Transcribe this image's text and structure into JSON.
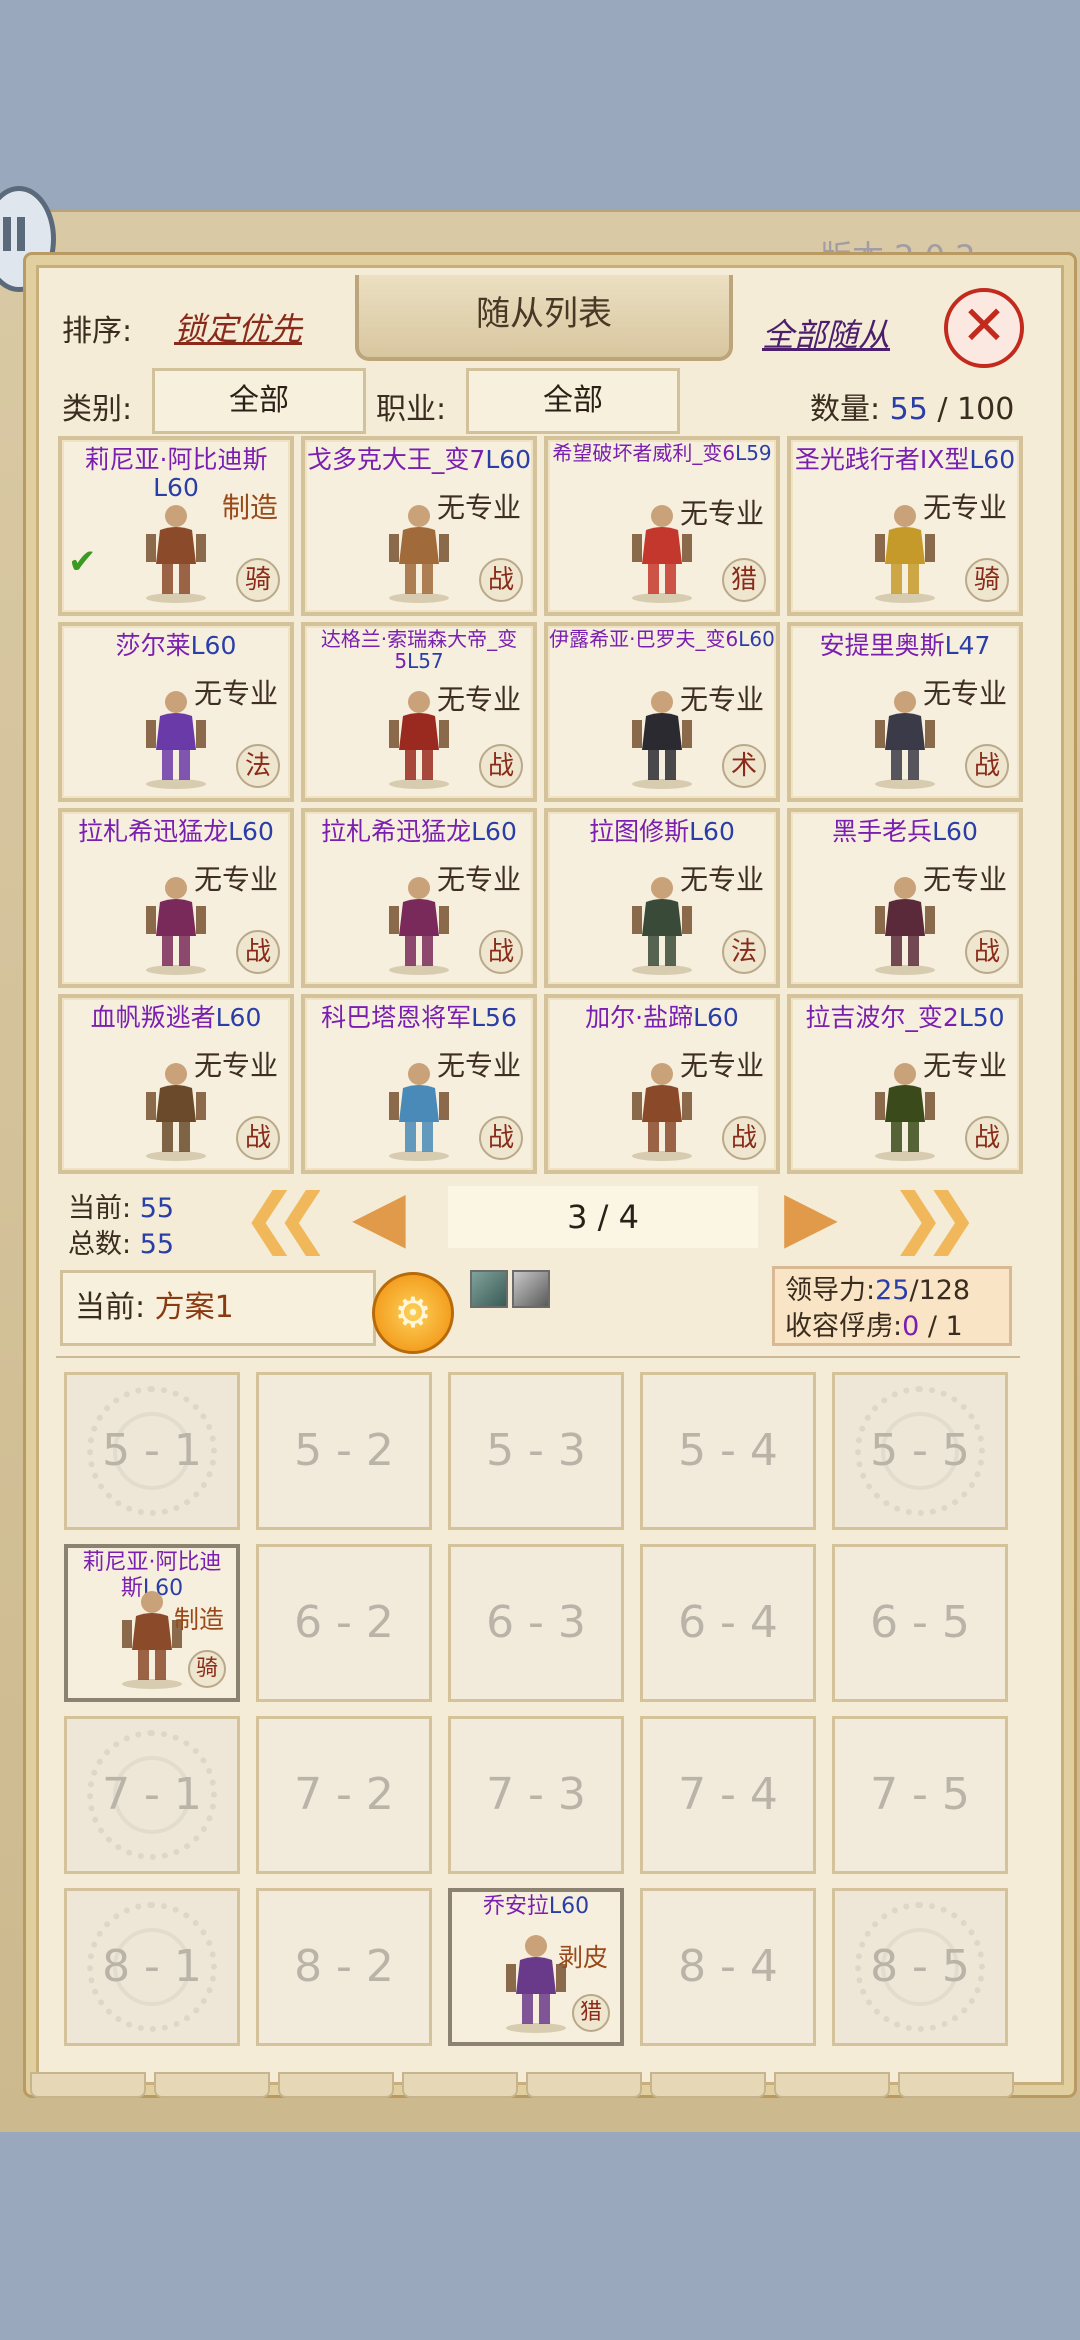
{
  "header": {
    "version_text": "版本 2.0.2",
    "title": "随从列表",
    "sort_label": "排序:",
    "sort_value": "锁定优先",
    "all_followers": "全部随从",
    "close_icon": "close-icon"
  },
  "filters": {
    "category_label": "类别:",
    "category_value": "全部",
    "job_label": "职业:",
    "job_value": "全部",
    "count_label": "数量:",
    "count_current": "55",
    "count_sep": " / ",
    "count_max": "100"
  },
  "cards": [
    {
      "name": "莉尼亚·阿比迪斯",
      "level": "L60",
      "prof": "制造",
      "cls": "骑",
      "crafted": true,
      "checked": true,
      "color": "#8b4a2a"
    },
    {
      "name": "戈多克大王_变7",
      "level": "L60",
      "prof": "无专业",
      "cls": "战",
      "color": "#a06a3a"
    },
    {
      "name": "希望破坏者威利_变6",
      "level": "L59",
      "prof": "无专业",
      "cls": "猎",
      "small": true,
      "color": "#c4372c"
    },
    {
      "name": "圣光践行者IX型",
      "level": "L60",
      "prof": "无专业",
      "cls": "骑",
      "color": "#c69a2a"
    },
    {
      "name": "莎尔莱",
      "level": "L60",
      "prof": "无专业",
      "cls": "法",
      "color": "#6a3aa8"
    },
    {
      "name": "达格兰·索瑞森大帝_变5",
      "level": "L57",
      "prof": "无专业",
      "cls": "战",
      "small": true,
      "color": "#9a2a20"
    },
    {
      "name": "伊露希亚·巴罗夫_变6",
      "level": "L60",
      "prof": "无专业",
      "cls": "术",
      "small": true,
      "color": "#2a2a30"
    },
    {
      "name": "安提里奥斯",
      "level": "L47",
      "prof": "无专业",
      "cls": "战",
      "color": "#3a3a48"
    },
    {
      "name": "拉札希迅猛龙",
      "level": "L60",
      "prof": "无专业",
      "cls": "战",
      "color": "#7a2a5a"
    },
    {
      "name": "拉札希迅猛龙",
      "level": "L60",
      "prof": "无专业",
      "cls": "战",
      "color": "#7a2a5a"
    },
    {
      "name": "拉图修斯",
      "level": "L60",
      "prof": "无专业",
      "cls": "法",
      "color": "#3a4a38"
    },
    {
      "name": "黑手老兵",
      "level": "L60",
      "prof": "无专业",
      "cls": "战",
      "color": "#5a2a3a"
    },
    {
      "name": "血帆叛逃者",
      "level": "L60",
      "prof": "无专业",
      "cls": "战",
      "color": "#6a4a2a"
    },
    {
      "name": "科巴塔恩将军",
      "level": "L56",
      "prof": "无专业",
      "cls": "战",
      "color": "#4a8ab8"
    },
    {
      "name": "加尔·盐蹄",
      "level": "L60",
      "prof": "无专业",
      "cls": "战",
      "color": "#8a4a2a"
    },
    {
      "name": "拉吉波尔_变2",
      "level": "L50",
      "prof": "无专业",
      "cls": "战",
      "color": "#3a4a1a"
    }
  ],
  "stats": {
    "current_label": "当前:",
    "current_value": "55",
    "total_label": "总数:",
    "total_value": "55"
  },
  "pager": {
    "page_text": "3 / 4"
  },
  "plan": {
    "label": "当前:",
    "value": "方案1"
  },
  "leadership": {
    "lead_label": "领导力:",
    "lead_current": "25",
    "lead_max": "/128",
    "captive_label": "收容俘虏:",
    "captive_current": "0",
    "captive_max": " / 1"
  },
  "formation": [
    [
      "5 - 1",
      "5 - 2",
      "5 - 3",
      "5 - 4",
      "5 - 5"
    ],
    [
      "",
      "6 - 2",
      "6 - 3",
      "6 - 4",
      "6 - 5"
    ],
    [
      "7 - 1",
      "7 - 2",
      "7 - 3",
      "7 - 4",
      "7 - 5"
    ],
    [
      "8 - 1",
      "8 - 2",
      "",
      "8 - 4",
      "8 - 5"
    ]
  ],
  "formation_units": {
    "slot_6_1": {
      "name": "莉尼亚·阿比迪斯",
      "level": "L60",
      "prof": "制造",
      "cls": "骑"
    },
    "slot_8_3": {
      "name": "乔安拉",
      "level": "L60",
      "prof": "剥皮",
      "cls": "猎"
    }
  }
}
